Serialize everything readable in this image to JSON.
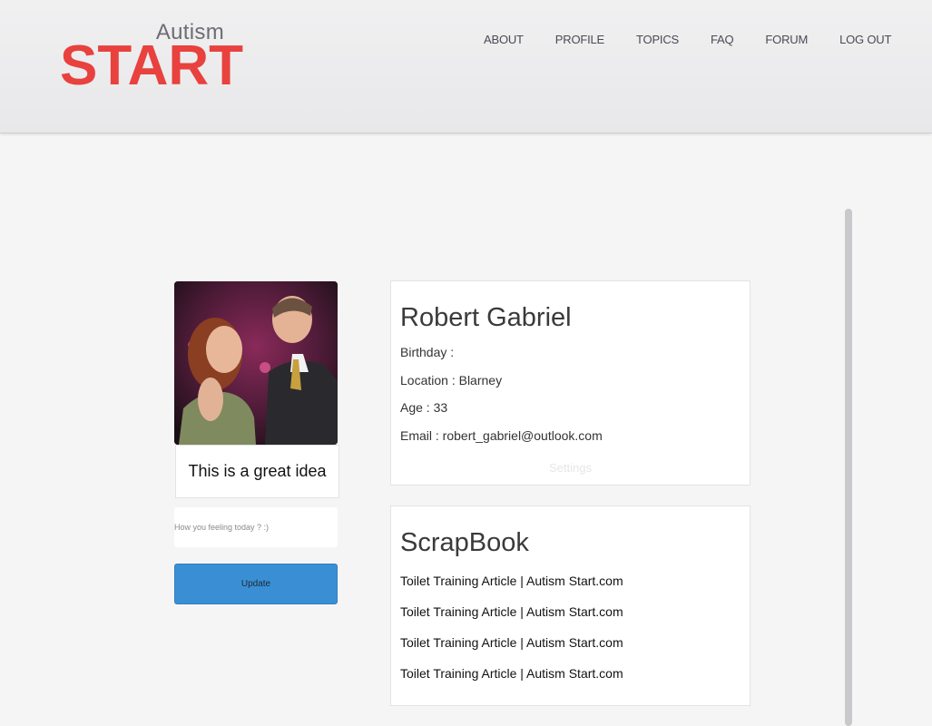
{
  "logo": {
    "small": "Autism",
    "big": "START"
  },
  "nav": [
    {
      "label": "ABOUT"
    },
    {
      "label": "PROFILE"
    },
    {
      "label": "TOPICS"
    },
    {
      "label": "FAQ"
    },
    {
      "label": "FORUM"
    },
    {
      "label": "LOG OUT"
    }
  ],
  "sidebar": {
    "status_text": "This is a great idea",
    "status_placeholder": "How you feeling today ? :)",
    "update_label": "Update"
  },
  "profile": {
    "name": "Robert Gabriel",
    "birthday": "Birthday :",
    "location": "Location : Blarney",
    "age": "Age : 33",
    "email": "Email : robert_gabriel@outlook.com",
    "settings_label": "Settings"
  },
  "scrapbook": {
    "title": "ScrapBook",
    "items": [
      {
        "label": "Toilet Training Article | Autism Start.com"
      },
      {
        "label": "Toilet Training Article | Autism Start.com"
      },
      {
        "label": "Toilet Training Article | Autism Start.com"
      },
      {
        "label": "Toilet Training Article | Autism Start.com"
      }
    ]
  },
  "colors": {
    "brand": "#e8413e",
    "button": "#3a8fd4"
  }
}
